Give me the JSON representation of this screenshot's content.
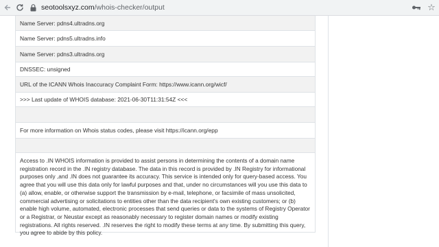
{
  "browser": {
    "url_host": "seotoolsxyz.com",
    "url_path": "/whois-checker/output",
    "colors": {
      "toolbar_bg": "#f1f3f4",
      "icon": "#5f6368"
    },
    "icons": [
      "back-arrow-icon",
      "reload-icon",
      "lock-icon",
      "key-icon",
      "star-icon"
    ]
  },
  "whois": {
    "rows": [
      "Name Server: pdns4.ultradns.org",
      "Name Server: pdns5.ultradns.info",
      "Name Server: pdns3.ultradns.org",
      "DNSSEC: unsigned",
      "URL of the ICANN Whois Inaccuracy Complaint Form: https://www.icann.org/wicf/",
      ">>> Last update of WHOIS database: 2021-06-30T11:31:54Z <<<",
      "",
      "For more information on Whois status codes, please visit https://icann.org/epp",
      ""
    ],
    "notice": "Access to .IN WHOIS information is provided to assist persons in determining the contents of a domain name registration record in the .IN registry database. The data in this record is provided by .IN Registry for informational purposes only ,and .IN does not guarantee its accuracy. This service is intended only for query-based access. You agree that you will use this data only for lawful purposes and that, under no circumstances will you use this data to (a) allow, enable, or otherwise support the transmission by e-mail, telephone, or facsimile of mass unsolicited, commercial advertising or solicitations to entities other than the data recipient's own existing customers; or (b) enable high volume, automated, electronic processes that send queries or data to the systems of Registry Operator or a Registrar, or Neustar except as reasonably necessary to register domain names or modify existing registrations. All rights reserved. .IN reserves the right to modify these terms at any time. By submitting this query, you agree to abide by this policy.",
    "colors": {
      "row_alt_bg": "#f2f2f2",
      "border": "#dee2e6",
      "text": "#333333"
    }
  }
}
